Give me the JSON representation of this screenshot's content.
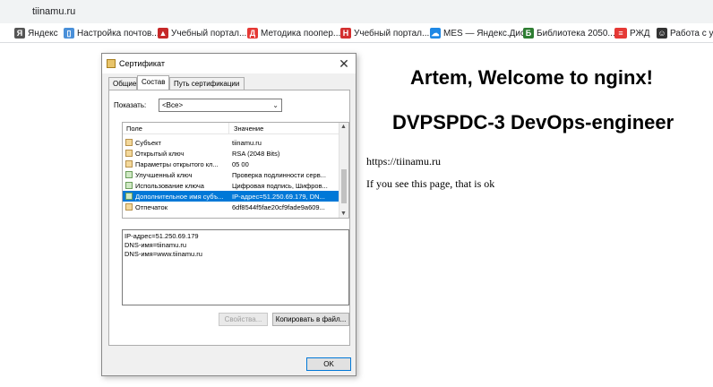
{
  "browser": {
    "url": "tiinamu.ru",
    "bookmarks": [
      {
        "label": "Яндекс",
        "icon": "yandex-icon",
        "color": "#555555"
      },
      {
        "label": "Настройка почтов...",
        "icon": "book-icon",
        "color": "#4a90d9"
      },
      {
        "label": "Учебный портал...",
        "icon": "graduation-cap-icon",
        "color": "#c62828"
      },
      {
        "label": "Методика пооп​ер...",
        "icon": "document-icon",
        "color": "#e53935"
      },
      {
        "label": "Учебный портал...",
        "icon": "hh-icon",
        "color": "#d32f2f"
      },
      {
        "label": "MES — Яндекс.Диск",
        "icon": "cloud-icon",
        "color": "#1e88e5"
      },
      {
        "label": "Библиотека 2050...",
        "icon": "library-icon",
        "color": "#2e7d32"
      },
      {
        "label": "РЖД",
        "icon": "rzd-icon",
        "color": "#e53935"
      },
      {
        "label": "Работа с у",
        "icon": "robot-icon",
        "color": "#333333"
      }
    ]
  },
  "page": {
    "welcome": "Artem, Welcome to nginx!",
    "subtitle": "DVPSPDC-3 DevOps-engineer",
    "url_text": "https://tiinamu.ru",
    "message": "If you see this page, that is ok"
  },
  "dialog": {
    "title": "Сертификат",
    "close": "✕",
    "tabs": [
      "Общие",
      "Состав",
      "Путь сертификации"
    ],
    "show_label": "Показать:",
    "show_value": "<Все>",
    "columns": {
      "field": "Поле",
      "value": "Значение"
    },
    "rows": [
      {
        "name": "Субъект",
        "value": "tiinamu.ru"
      },
      {
        "name": "Открытый ключ",
        "value": "RSA (2048 Bits)"
      },
      {
        "name": "Параметры открытого кл...",
        "value": "05 00"
      },
      {
        "name": "Улучшенный ключ",
        "value": "Проверка подлинности серв..."
      },
      {
        "name": "Использование ключа",
        "value": "Цифровая подпись, Шифров..."
      },
      {
        "name": "Дополнительное имя субъ...",
        "value": "IP-адрес=51.250.69.179, DN..."
      },
      {
        "name": "Отпечаток",
        "value": "6df8544f5fae20cf9fade9a609..."
      }
    ],
    "details": [
      "IP-адрес=51.250.69.179",
      "DNS-имя=tiinamu.ru",
      "DNS-имя=www.tiinamu.ru"
    ],
    "btn_properties": "Свойства...",
    "btn_copy": "Копировать в файл...",
    "btn_ok": "OK"
  }
}
